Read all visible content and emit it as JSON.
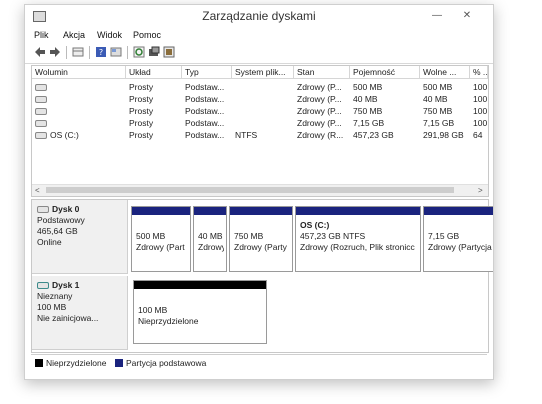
{
  "window": {
    "title": "Zarządzanie dyskami"
  },
  "menu": [
    "Plik",
    "Akcja",
    "Widok",
    "Pomoc"
  ],
  "toolbar_icons": [
    "back-arrow-icon",
    "forward-arrow-icon",
    "list-view-icon",
    "help-icon",
    "properties-icon",
    "refresh-icon",
    "disk-settings-icon",
    "rescan-disks-icon"
  ],
  "volumes": {
    "headers": [
      "Wolumin",
      "Układ",
      "Typ",
      "System plik...",
      "Stan",
      "Pojemność",
      "Wolne ...",
      "% ..."
    ],
    "rows": [
      [
        "",
        "Prosty",
        "Podstaw...",
        "",
        "Zdrowy (P...",
        "500 MB",
        "500 MB",
        "100"
      ],
      [
        "",
        "Prosty",
        "Podstaw...",
        "",
        "Zdrowy (P...",
        "40 MB",
        "40 MB",
        "100"
      ],
      [
        "",
        "Prosty",
        "Podstaw...",
        "",
        "Zdrowy (P...",
        "750 MB",
        "750 MB",
        "100"
      ],
      [
        "",
        "Prosty",
        "Podstaw...",
        "",
        "Zdrowy (P...",
        "7,15 GB",
        "7,15 GB",
        "100"
      ],
      [
        "OS (C:)",
        "Prosty",
        "Podstaw...",
        "NTFS",
        "Zdrowy (R...",
        "457,23 GB",
        "291,98 GB",
        "64"
      ]
    ]
  },
  "disk0": {
    "name": "Dysk 0",
    "type": "Podstawowy",
    "size": "465,64 GB",
    "state": "Online",
    "partitions": [
      {
        "name": "",
        "size": "500 MB",
        "status": "Zdrowy (Part"
      },
      {
        "name": "",
        "size": "40 MB",
        "status": "Zdrowy"
      },
      {
        "name": "",
        "size": "750 MB",
        "status": "Zdrowy (Party"
      },
      {
        "name": "OS  (C:)",
        "size": "457,23 GB NTFS",
        "status": "Zdrowy (Rozruch, Plik stronicc"
      },
      {
        "name": "",
        "size": "7,15 GB",
        "status": "Zdrowy (Partycja od"
      }
    ]
  },
  "disk1": {
    "name": "Dysk 1",
    "type": "Nieznany",
    "size": "100 MB",
    "state": "Nie zainicjowa...",
    "partition": {
      "size": "100 MB",
      "status": "Nieprzydzielone"
    }
  },
  "legend": [
    {
      "label": "Nieprzydzielone",
      "color": "#000000"
    },
    {
      "label": "Partycja podstawowa",
      "color": "#1a237e"
    }
  ]
}
